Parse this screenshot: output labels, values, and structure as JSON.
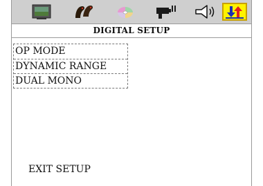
{
  "icon_bar": {
    "icons": [
      "tv-icon",
      "parrots-icon",
      "disc-icon",
      "camera-icon",
      "speaker-icon",
      "updown-arrows-icon"
    ],
    "selected_icon": "updown-arrows-icon"
  },
  "page": {
    "title": "DIGITAL SETUP"
  },
  "menu": {
    "items": [
      {
        "label": "OP MODE"
      },
      {
        "label": "DYNAMIC RANGE"
      },
      {
        "label": "DUAL MONO"
      }
    ]
  },
  "footer": {
    "exit_label": "EXIT SETUP"
  },
  "colors": {
    "bar_background": "#cfcfcf",
    "selected_highlight": "#fff200",
    "arrow_red": "#e02020",
    "arrow_blue": "#1a2fb0"
  }
}
